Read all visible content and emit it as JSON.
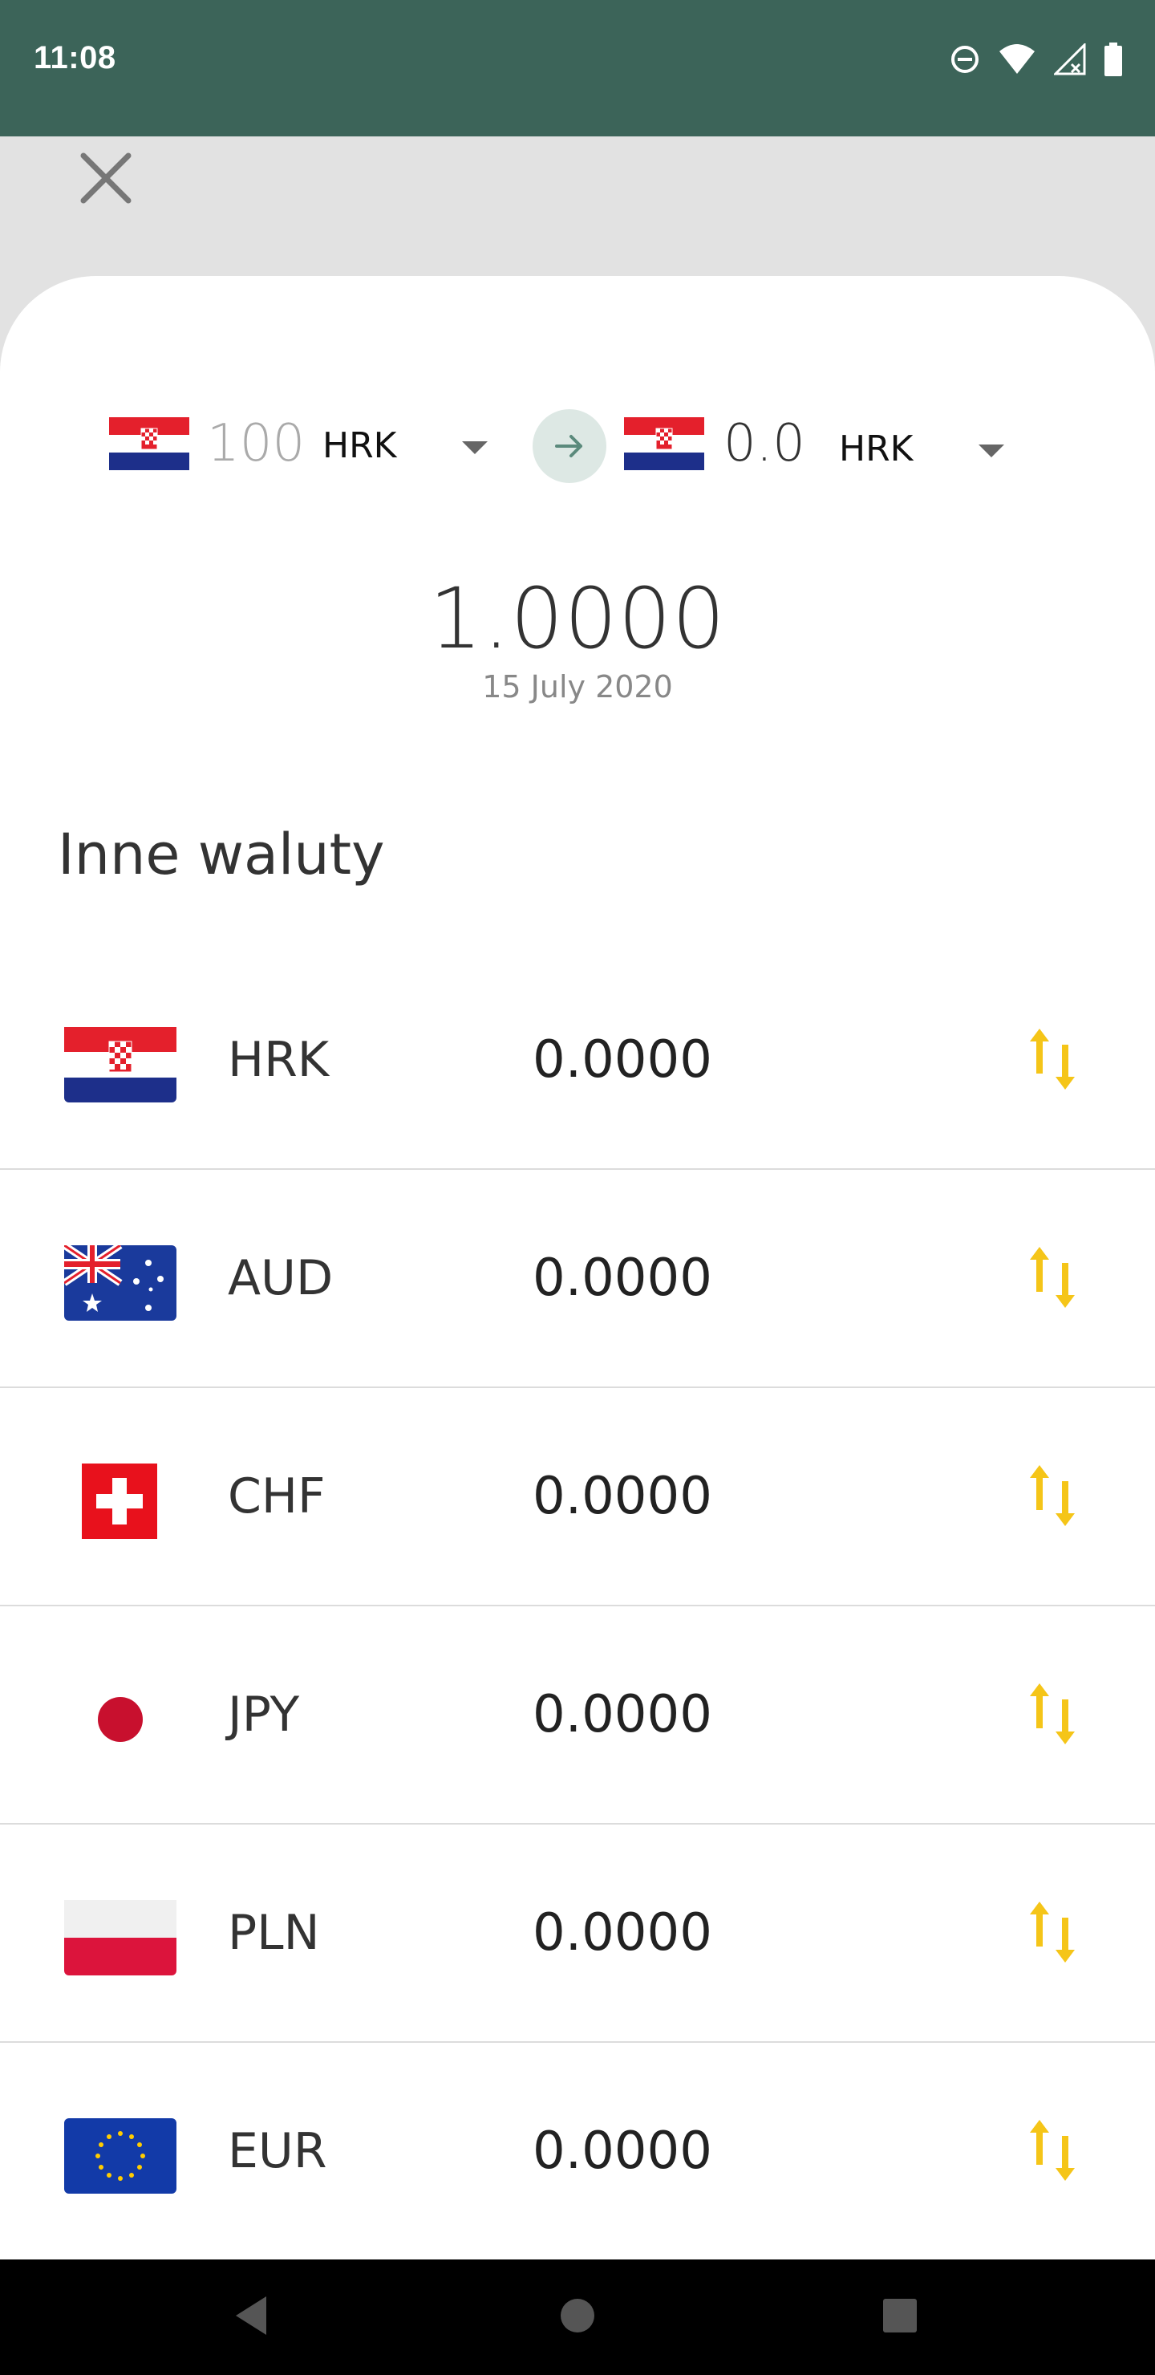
{
  "status_bar": {
    "time": "11:08",
    "icons": [
      "do-not-disturb-icon",
      "wifi-icon",
      "signal-icon",
      "battery-icon"
    ]
  },
  "header": {
    "close_icon": "close-icon"
  },
  "converter": {
    "from": {
      "amount": "100",
      "code": "HRK",
      "flag": "croatia"
    },
    "to": {
      "amount": "0.0",
      "code": "HRK",
      "flag": "croatia"
    },
    "swap_icon": "arrow-right-icon"
  },
  "rate": {
    "value": "1.0000",
    "date": "15 July 2020"
  },
  "section_title": "Inne waluty",
  "currencies": [
    {
      "code": "HRK",
      "value": "0.0000",
      "flag": "croatia"
    },
    {
      "code": "AUD",
      "value": "0.0000",
      "flag": "australia"
    },
    {
      "code": "CHF",
      "value": "0.0000",
      "flag": "switzerland"
    },
    {
      "code": "JPY",
      "value": "0.0000",
      "flag": "japan"
    },
    {
      "code": "PLN",
      "value": "0.0000",
      "flag": "poland"
    },
    {
      "code": "EUR",
      "value": "0.0000",
      "flag": "eu"
    }
  ],
  "colors": {
    "status_bar": "#3c6459",
    "accent_swap": "#f5c518",
    "swap_circle": "#dde8e4",
    "divider": "#dcdcdc"
  },
  "nav_bar": {
    "icons": [
      "back-icon",
      "home-icon",
      "recents-icon"
    ]
  }
}
